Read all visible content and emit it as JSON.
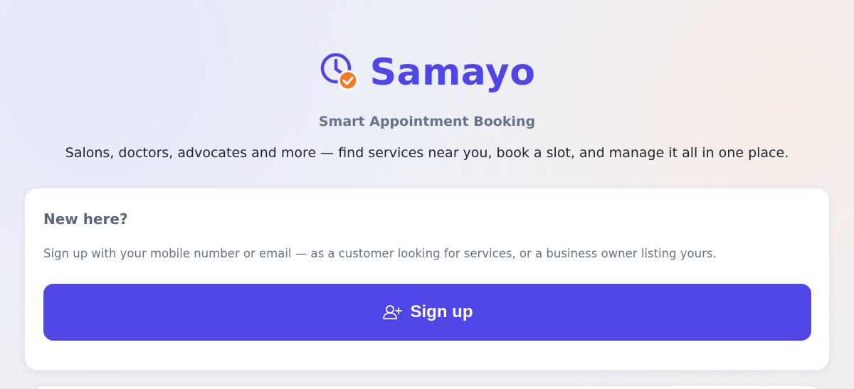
{
  "brand": {
    "name": "Samayo",
    "icon": "clock-check-icon",
    "primary_color": "#4f46e5",
    "accent_color": "#f27a24"
  },
  "tagline": "Smart Appointment Booking",
  "description": "Salons, doctors, advocates and more — find services near you, book a slot, and manage it all in one place.",
  "signup_card": {
    "title": "New here?",
    "text": "Sign up with your mobile number or email — as a customer looking for services, or a business owner listing yours.",
    "button": {
      "label": "Sign up",
      "icon": "user-plus-icon"
    }
  }
}
